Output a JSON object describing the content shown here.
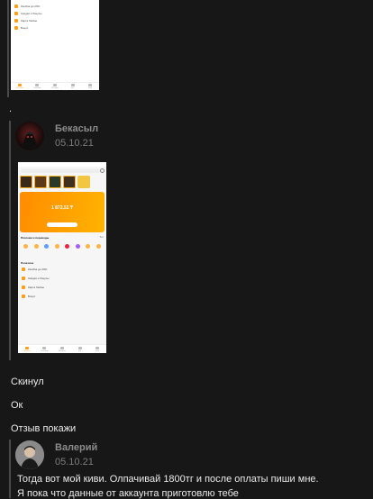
{
  "first_screenshot": {
    "menu": [
      {
        "label": "Кэшбэк до 20%"
      },
      {
        "label": "Скидки и бонусы"
      },
      {
        "label": "Карта Халвы"
      },
      {
        "label": "Бонус"
      }
    ],
    "tabs": [
      "Главная",
      "Платежи",
      "История",
      "Чат",
      "Ещё"
    ]
  },
  "separator_dot": ".",
  "post1": {
    "author": "Бекасыл",
    "date": "05.10.21",
    "screenshot": {
      "balance": "1 872,51 ₸",
      "section_title": "Платежи и переводы",
      "section_link": "Все",
      "list_title": "Полезное",
      "list": [
        {
          "label": "Кэшбэк до 20%"
        },
        {
          "label": "Скидки и бонусы"
        },
        {
          "label": "Карта Халвы"
        },
        {
          "label": "Бонус"
        }
      ],
      "tabs": [
        "Главная",
        "Платежи",
        "История",
        "Чат",
        "Ещё"
      ]
    }
  },
  "messages": [
    "Скинул",
    "Ок",
    "Отзыв покажи"
  ],
  "post2": {
    "author": "Валерий",
    "date": "05.10.21",
    "lines": [
      "Тогда вот мой киви. Олпачивай 1800тг и после оплаты пиши мне.",
      "Я пока что данные от аккаунта приготовлю тебе"
    ]
  },
  "colors": {
    "background": "#171717",
    "accent": "#ff9e1b",
    "name": "#8b8b8b"
  }
}
